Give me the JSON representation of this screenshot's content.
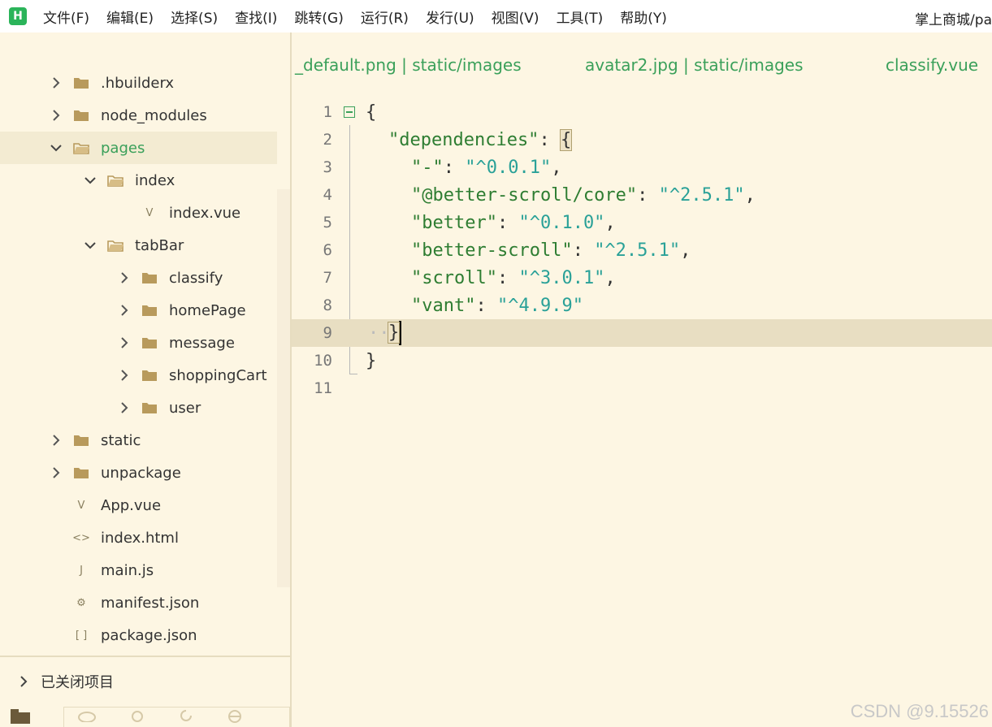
{
  "app": {
    "logo": "H"
  },
  "menu": [
    "文件(F)",
    "编辑(E)",
    "选择(S)",
    "查找(I)",
    "跳转(G)",
    "运行(R)",
    "发行(U)",
    "视图(V)",
    "工具(T)",
    "帮助(Y)"
  ],
  "window_title": "掌上商城/pa",
  "tree": [
    {
      "label": ".hbuilderx",
      "type": "folder",
      "expanded": false
    },
    {
      "label": "node_modules",
      "type": "folder",
      "expanded": false
    },
    {
      "label": "pages",
      "type": "folder",
      "expanded": true,
      "selected": true
    },
    {
      "label": "index",
      "type": "folder",
      "expanded": true
    },
    {
      "label": "index.vue",
      "type": "vue"
    },
    {
      "label": "tabBar",
      "type": "folder",
      "expanded": true
    },
    {
      "label": "classify",
      "type": "folder",
      "expanded": false
    },
    {
      "label": "homePage",
      "type": "folder",
      "expanded": false
    },
    {
      "label": "message",
      "type": "folder",
      "expanded": false
    },
    {
      "label": "shoppingCart",
      "type": "folder",
      "expanded": false
    },
    {
      "label": "user",
      "type": "folder",
      "expanded": false
    },
    {
      "label": "static",
      "type": "folder",
      "expanded": false
    },
    {
      "label": "unpackage",
      "type": "folder",
      "expanded": false
    },
    {
      "label": "App.vue",
      "type": "vue"
    },
    {
      "label": "index.html",
      "type": "html"
    },
    {
      "label": "main.js",
      "type": "js"
    },
    {
      "label": "manifest.json",
      "type": "manifest"
    },
    {
      "label": "package.json",
      "type": "json"
    }
  ],
  "closed_projects_label": "已关闭项目",
  "tabs": [
    "_default.png | static/images",
    "avatar2.jpg | static/images",
    "classify.vue"
  ],
  "code": {
    "line_numbers": [
      "1",
      "2",
      "3",
      "4",
      "5",
      "6",
      "7",
      "8",
      "9",
      "10",
      "11"
    ],
    "open_brace": "{",
    "close_brace": "}",
    "inner_close": "}",
    "dependencies_key": "\"dependencies\"",
    "deps": [
      {
        "key": "\"-\"",
        "value": "\"^0.0.1\""
      },
      {
        "key": "\"@better-scroll/core\"",
        "value": "\"^2.5.1\""
      },
      {
        "key": "\"better\"",
        "value": "\"^0.1.0\""
      },
      {
        "key": "\"better-scroll\"",
        "value": "\"^2.5.1\""
      },
      {
        "key": "\"scroll\"",
        "value": "\"^3.0.1\""
      },
      {
        "key": "\"vant\"",
        "value": "\"^4.9.9\""
      }
    ]
  },
  "watermark": "CSDN @9.15526",
  "colors": {
    "accent": "#3aa05a",
    "background": "#fdf6e3",
    "string": "#2aa198",
    "key": "#2e7d32"
  }
}
